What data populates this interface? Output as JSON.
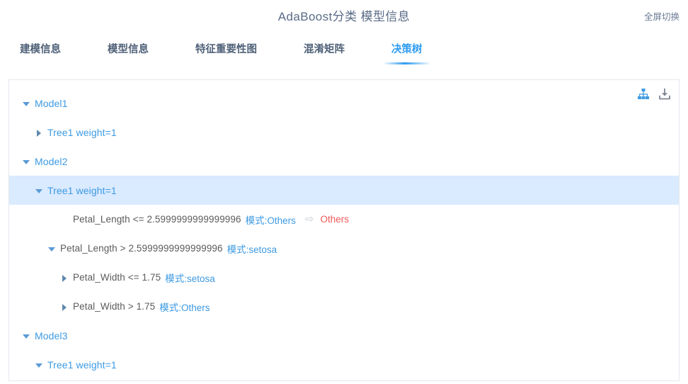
{
  "header": {
    "title": "AdaBoost分类 模型信息",
    "fullscreen_toggle": "全屏切换"
  },
  "tabs": [
    {
      "label": "建模信息",
      "active": false
    },
    {
      "label": "模型信息",
      "active": false
    },
    {
      "label": "特征重要性图",
      "active": false
    },
    {
      "label": "混淆矩阵",
      "active": false
    },
    {
      "label": "决策树",
      "active": true
    }
  ],
  "panel": {
    "actions": [
      {
        "name": "tree-graph-icon",
        "title": "结构图"
      },
      {
        "name": "download-icon",
        "title": "下载"
      }
    ],
    "tree": [
      {
        "id": "model1",
        "indent": "lvl0",
        "toggle": "down",
        "label": "Model1",
        "type": "model",
        "selected": false
      },
      {
        "id": "model1-tree1",
        "indent": "lvl1",
        "toggle": "right",
        "label": "Tree1 weight=1",
        "type": "tree",
        "selected": false
      },
      {
        "id": "model2",
        "indent": "lvl0",
        "toggle": "down",
        "label": "Model2",
        "type": "model",
        "selected": false
      },
      {
        "id": "model2-tree1",
        "indent": "lvl1",
        "toggle": "down",
        "label": "Tree1 weight=1",
        "type": "tree",
        "selected": true
      },
      {
        "id": "m2t1-node1",
        "indent": "lvl3",
        "toggle": "none",
        "condition": "Petal_Length <= 2.5999999999999996",
        "mode": "模式:Others",
        "leaf_arrow": "⇨",
        "leaf_value": "Others",
        "type": "leaf",
        "selected": false
      },
      {
        "id": "m2t1-node2",
        "indent": "lvl2",
        "toggle": "down",
        "condition": "Petal_Length > 2.5999999999999996",
        "mode": "模式:setosa",
        "type": "branch",
        "selected": false
      },
      {
        "id": "m2t1-node3",
        "indent": "lvl3",
        "toggle": "right",
        "condition": "Petal_Width <= 1.75",
        "mode": "模式:setosa",
        "type": "branch",
        "selected": false
      },
      {
        "id": "m2t1-node4",
        "indent": "lvl3",
        "toggle": "right",
        "condition": "Petal_Width > 1.75",
        "mode": "模式:Others",
        "type": "branch",
        "selected": false
      },
      {
        "id": "model3",
        "indent": "lvl0",
        "toggle": "down",
        "label": "Model3",
        "type": "model",
        "selected": false
      },
      {
        "id": "model3-tree1",
        "indent": "lvl1",
        "toggle": "down",
        "label": "Tree1 weight=1",
        "type": "tree",
        "selected": false
      }
    ]
  },
  "colors": {
    "accent": "#2f9cf0",
    "node_blue": "#3d9ae2",
    "leaf_red": "#f05b5b",
    "selected_bg": "#daeaff",
    "title_text": "#5a6b87",
    "tab_text": "#4f6178"
  }
}
